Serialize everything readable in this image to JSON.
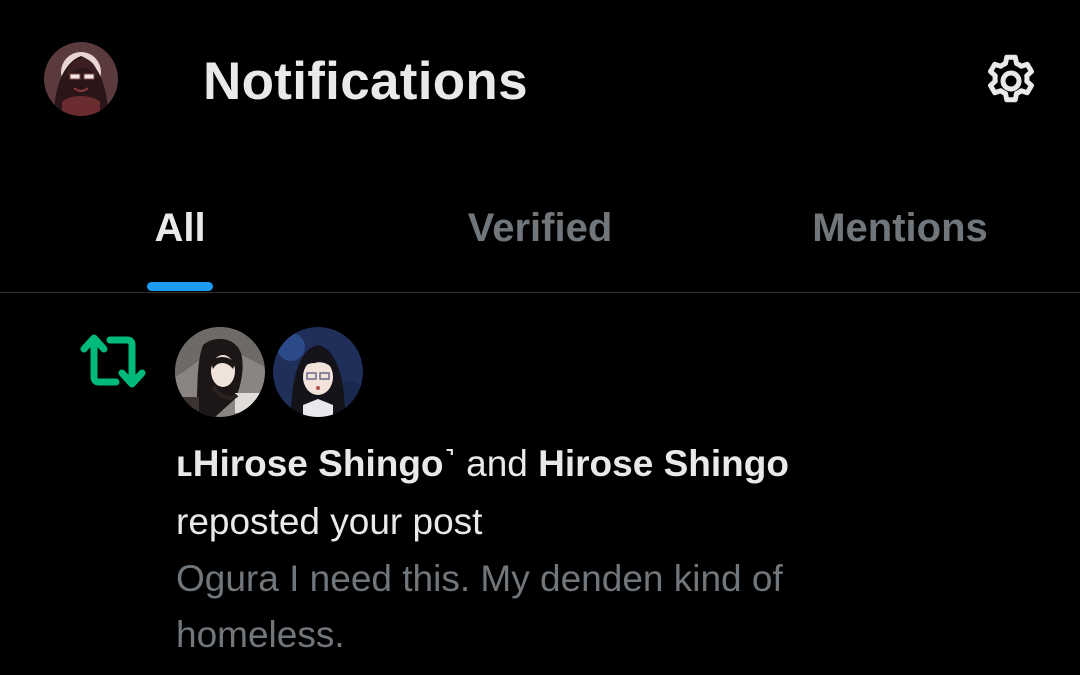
{
  "header": {
    "title": "Notifications",
    "profile_avatar_icon": "user-avatar",
    "settings_icon": "gear-icon"
  },
  "tabs": [
    {
      "label": "All",
      "active": true
    },
    {
      "label": "Verified",
      "active": false
    },
    {
      "label": "Mentions",
      "active": false
    }
  ],
  "notification": {
    "type_icon": "repost-icon",
    "actor_1": "ʟHirose Shingo˺",
    "connector": " and ",
    "actor_2": "Hirose Shingo",
    "action": "reposted your post",
    "post_preview": "Ogura I need this. My denden kind of homeless."
  },
  "colors": {
    "background": "#000000",
    "text_primary": "#e7e9ea",
    "text_secondary": "#71767b",
    "accent_blue": "#1d9bf0",
    "repost_green": "#00ba7c",
    "divider": "#2f3336"
  }
}
